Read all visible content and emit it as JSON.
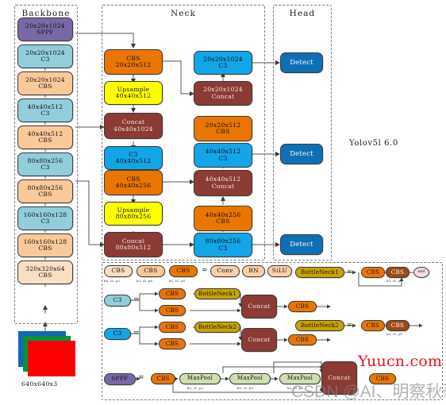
{
  "title": "Yolov5l 6.0",
  "groups": [
    {
      "name": "backbone",
      "label": "Backbone"
    },
    {
      "name": "neck",
      "label": "Neck"
    },
    {
      "name": "head",
      "label": "Head"
    },
    {
      "name": "legend",
      "label": ""
    }
  ],
  "backbone": {
    "input_label": "640x640x3",
    "blocks": [
      {
        "l1": "20x20x1024",
        "l2": "SPPF"
      },
      {
        "l1": "20x20x1024",
        "l2": "C3"
      },
      {
        "l1": "20x20x1024",
        "l2": "CBS"
      },
      {
        "l1": "40x40x512",
        "l2": "C3"
      },
      {
        "l1": "40x40x512",
        "l2": "CBS"
      },
      {
        "l1": "80x80x256",
        "l2": "C3"
      },
      {
        "l1": "80x80x256",
        "l2": "CBS"
      },
      {
        "l1": "160x160x128",
        "l2": "C3"
      },
      {
        "l1": "160x160x128",
        "l2": "CBS"
      },
      {
        "l1": "320x320x64",
        "l2": "CBS"
      }
    ]
  },
  "neck": {
    "left_blocks": [
      {
        "l1": "CBS",
        "l2": "20x20x512"
      },
      {
        "l1": "Upsample",
        "l2": "40x40x512"
      },
      {
        "l1": "Concat",
        "l2": "40x40x1024"
      },
      {
        "l1": "C3",
        "l2": "40x40x512"
      },
      {
        "l1": "CBS",
        "l2": "40x40x256"
      },
      {
        "l1": "Upsample",
        "l2": "80x80x256"
      },
      {
        "l1": "Concat",
        "l2": "80x80x512"
      }
    ],
    "right_blocks": [
      {
        "l1": "20x20x1024",
        "l2": "C3"
      },
      {
        "l1": "20x20x1024",
        "l2": "Concat"
      },
      {
        "l1": "20x20x512",
        "l2": "CBS"
      },
      {
        "l1": "40x40x512",
        "l2": "C3"
      },
      {
        "l1": "40x40x512",
        "l2": "Concat"
      },
      {
        "l1": "40x40x256",
        "l2": "CBS"
      },
      {
        "l1": "80x80x256",
        "l2": "C3"
      }
    ]
  },
  "head": {
    "detects": [
      "Detect",
      "Detect",
      "Detect"
    ]
  },
  "legend": {
    "cbs_row": {
      "items": [
        {
          "label": "CBS",
          "ann": "k6, s2, p2"
        },
        {
          "label": "CBS",
          "ann": "k3, s2, p0"
        },
        {
          "label": "CBS",
          "ann": "k1, s1, p0"
        }
      ],
      "equals": "=",
      "expands": [
        "Conv",
        "BN",
        "SiLU"
      ]
    },
    "c3_light": {
      "label": "C3",
      "equals": "=",
      "top_path": [
        "CBS",
        "BottleNeck1"
      ],
      "bottom_path": [
        "CBS"
      ],
      "join": "Concat",
      "out": "CBS"
    },
    "c3_bright": {
      "label": "C3",
      "equals": "=",
      "top_path": [
        "CBS",
        "BottleNeck2"
      ],
      "bottom_path": [
        "CBS"
      ],
      "join": "Concat",
      "out": "CBS"
    },
    "bottleneck1": {
      "label": "BottleNeck1",
      "equals": "=",
      "chain": [
        {
          "label": "CBS",
          "ann": ""
        },
        {
          "label": "CBS",
          "ann": "k3, s1, p1"
        }
      ],
      "op": "add"
    },
    "bottleneck2": {
      "label": "BottleNeck2",
      "equals": "=",
      "chain": [
        {
          "label": "CBS",
          "ann": ""
        },
        {
          "label": "CBS",
          "ann": "k3, s1, p1"
        }
      ]
    },
    "sppf": {
      "label": "SPPF",
      "equals": "=",
      "cbs": "CBS",
      "maxpools": [
        {
          "label": "MaxPool",
          "ann": "k5, s1, p2"
        },
        {
          "label": "MaxPool",
          "ann": "k5, s1, p2"
        },
        {
          "label": "MaxPool",
          "ann": "k5, s1, p2"
        }
      ],
      "join": "Concat",
      "out": "CBS"
    }
  },
  "watermarks": {
    "red": "Yuucn.com",
    "gray": "CSDN @AI、明察秋毫"
  },
  "colors": {
    "sppf": "#7a68a6",
    "c3_light": "#92cddc",
    "cbs_light": "#fac99a",
    "cbs_lightest": "#fbdfc4",
    "cbs": "#ea7600",
    "cbs_dark": "#9c4a12",
    "upsample": "#ffff00",
    "concat": "#8c3a34",
    "c3_bright": "#12a5e8",
    "detect": "#0f6fb5",
    "bottleneck": "#c8a400",
    "maxpool": "#cfdfb0",
    "conv": "#fbd0a8",
    "add": "#f6dede"
  }
}
